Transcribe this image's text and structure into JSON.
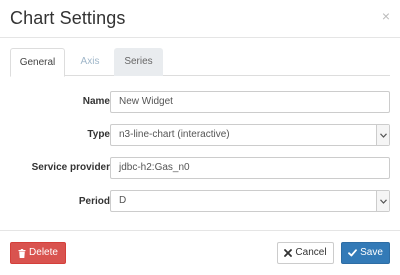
{
  "header": {
    "title": "Chart Settings",
    "close_glyph": "×"
  },
  "tabs": [
    {
      "label": "General",
      "active": true
    },
    {
      "label": "Axis",
      "active": false
    },
    {
      "label": "Series",
      "active": false
    }
  ],
  "form": {
    "name": {
      "label": "Name",
      "value": "New Widget"
    },
    "type": {
      "label": "Type",
      "value": "n3-line-chart (interactive)"
    },
    "service_provider": {
      "label": "Service provider",
      "value": "jdbc-h2:Gas_n0"
    },
    "period": {
      "label": "Period",
      "value": "D"
    }
  },
  "footer": {
    "delete_label": "Delete",
    "cancel_label": "Cancel",
    "save_label": "Save"
  },
  "icons": {
    "delete": "trash-icon",
    "cancel": "x-icon",
    "save": "checkmark-icon",
    "select": "chevron-down-icon"
  },
  "colors": {
    "delete_bg": "#d9534f",
    "save_bg": "#337ab7",
    "axis_tab_text": "#9fb6c9",
    "series_tab_bg": "#e9ecef"
  }
}
